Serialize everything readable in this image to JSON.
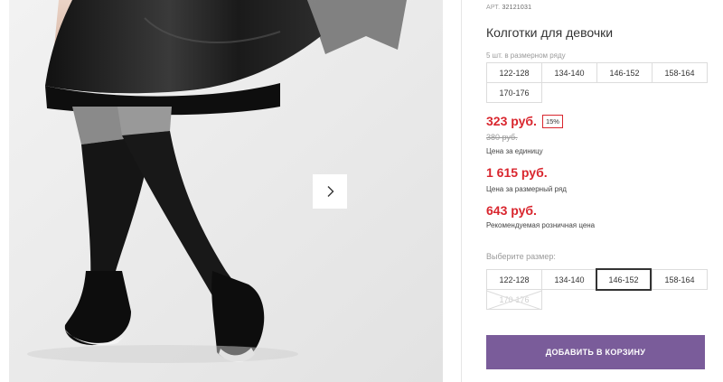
{
  "product": {
    "article_label": "АРТ.",
    "article_code": "32121031",
    "title": "Колготки для девочки",
    "pack_label": "5 шт. в размерном ряду",
    "pack_sizes": [
      "122-128",
      "134-140",
      "146-152",
      "158-164",
      "170-176"
    ],
    "price": {
      "current": "323 руб.",
      "discount": "15%",
      "old": "380 руб.",
      "unit_label": "Цена за единицу",
      "pack_price": "1 615 руб.",
      "pack_price_label": "Цена за размерный ряд",
      "rrp": "643 руб.",
      "rrp_label": "Рекомендуемая розничная цена"
    },
    "choose_size": {
      "label": "Выберите размер:",
      "sizes": [
        "122-128",
        "134-140",
        "146-152",
        "158-164",
        "170-176"
      ],
      "selected": "146-152",
      "unavailable": [
        "170-176"
      ]
    },
    "add_to_cart": "ДОБАВИТЬ В КОРЗИНУ"
  },
  "gallery": {
    "next_icon": "chevron-right-icon"
  },
  "colors": {
    "price_red": "#d9262e",
    "cart_button": "#7a5c9a",
    "border": "#dcdcdc",
    "muted_text": "#9a9a9a"
  }
}
